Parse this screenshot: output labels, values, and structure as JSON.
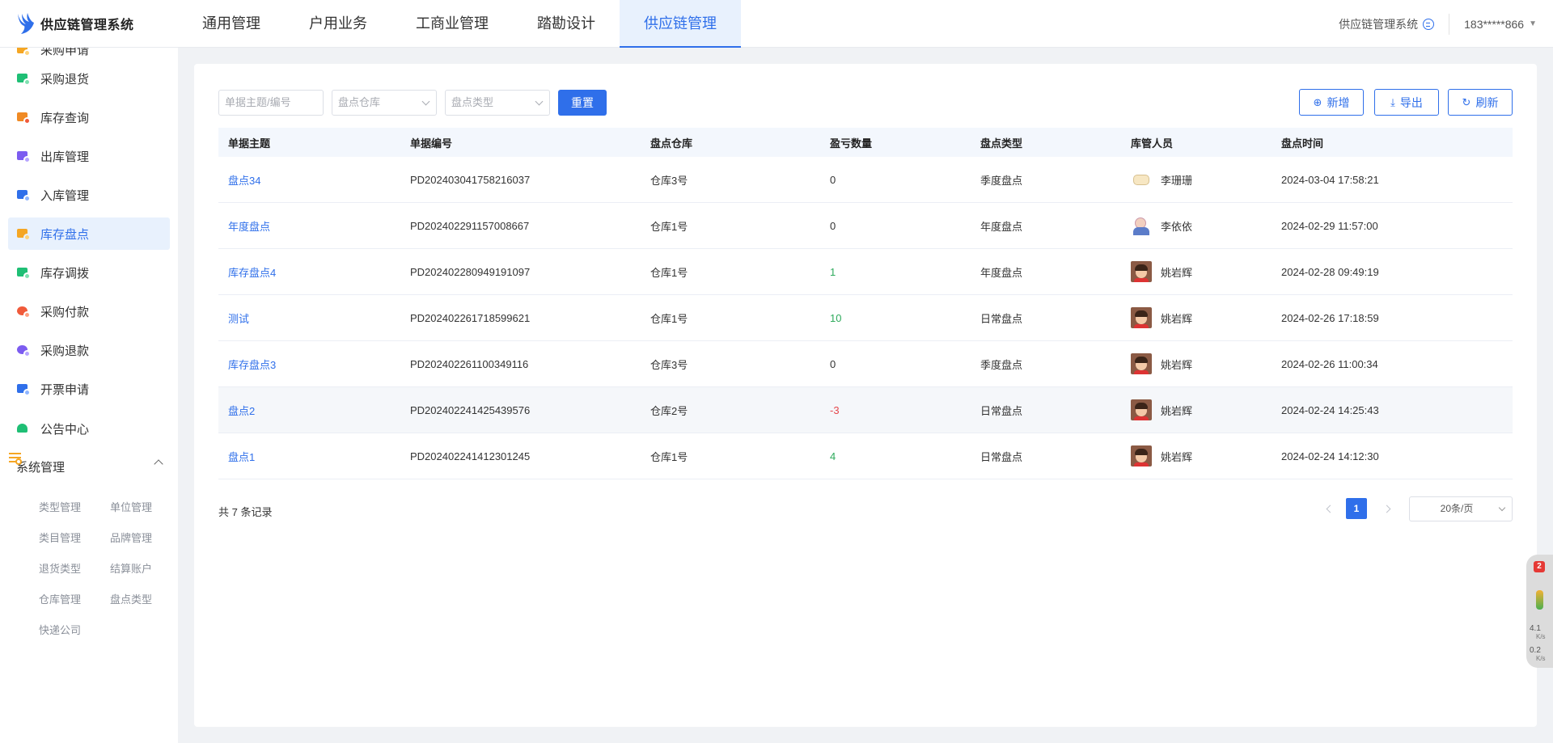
{
  "app": {
    "title": "供应链管理系统"
  },
  "top_nav": {
    "items": [
      {
        "label": "通用管理"
      },
      {
        "label": "户用业务"
      },
      {
        "label": "工商业管理"
      },
      {
        "label": "踏勘设计"
      },
      {
        "label": "供应链管理"
      }
    ],
    "active_index": 4
  },
  "header_right": {
    "system_name": "供应链管理系统",
    "user": "183*****866"
  },
  "sidebar": {
    "items": [
      {
        "label": "采购申请",
        "icon": "purchase-request-icon",
        "color": "#f5a623"
      },
      {
        "label": "采购退货",
        "icon": "cart-icon",
        "color": "#1fbf75"
      },
      {
        "label": "库存查询",
        "icon": "inventory-search-icon",
        "color": "#f08a24"
      },
      {
        "label": "出库管理",
        "icon": "outbound-icon",
        "color": "#7c5cf0"
      },
      {
        "label": "入库管理",
        "icon": "inbound-icon",
        "color": "#2f6fea"
      },
      {
        "label": "库存盘点",
        "icon": "stocktake-icon",
        "color": "#f5a623"
      },
      {
        "label": "库存调拨",
        "icon": "transfer-icon",
        "color": "#1fbf75"
      },
      {
        "label": "采购付款",
        "icon": "payment-icon",
        "color": "#f05a3a"
      },
      {
        "label": "采购退款",
        "icon": "refund-icon",
        "color": "#7c5cf0"
      },
      {
        "label": "开票申请",
        "icon": "invoice-icon",
        "color": "#2f6fea"
      },
      {
        "label": "公告中心",
        "icon": "bell-icon",
        "color": "#1fbf75"
      }
    ],
    "active_index": 5,
    "group": {
      "label": "系统管理",
      "icon": "settings-sliders-icon",
      "sub_items": [
        "类型管理",
        "单位管理",
        "类目管理",
        "品牌管理",
        "退货类型",
        "结算账户",
        "仓库管理",
        "盘点类型",
        "快递公司"
      ]
    }
  },
  "filters": {
    "subject_placeholder": "单据主题/编号",
    "warehouse_placeholder": "盘点仓库",
    "type_placeholder": "盘点类型",
    "reset_label": "重置"
  },
  "actions": {
    "add_label": "新增",
    "export_label": "导出",
    "refresh_label": "刷新"
  },
  "table": {
    "columns": [
      "单据主题",
      "单据编号",
      "盘点仓库",
      "盈亏数量",
      "盘点类型",
      "库管人员",
      "盘点时间"
    ],
    "rows": [
      {
        "subject": "盘点34",
        "number": "PD202403041758216037",
        "warehouse": "仓库3号",
        "qty": "0",
        "type": "季度盘点",
        "keeper": "李珊珊",
        "time": "2024-03-04 17:58:21"
      },
      {
        "subject": "年度盘点",
        "number": "PD202402291157008667",
        "warehouse": "仓库1号",
        "qty": "0",
        "type": "年度盘点",
        "keeper": "李依依",
        "time": "2024-02-29 11:57:00"
      },
      {
        "subject": "库存盘点4",
        "number": "PD202402280949191097",
        "warehouse": "仓库1号",
        "qty": "1",
        "type": "年度盘点",
        "keeper": "姚岩辉",
        "time": "2024-02-28 09:49:19"
      },
      {
        "subject": "测试",
        "number": "PD202402261718599621",
        "warehouse": "仓库1号",
        "qty": "10",
        "type": "日常盘点",
        "keeper": "姚岩辉",
        "time": "2024-02-26 17:18:59"
      },
      {
        "subject": "库存盘点3",
        "number": "PD202402261100349116",
        "warehouse": "仓库3号",
        "qty": "0",
        "type": "季度盘点",
        "keeper": "姚岩辉",
        "time": "2024-02-26 11:00:34"
      },
      {
        "subject": "盘点2",
        "number": "PD202402241425439576",
        "warehouse": "仓库2号",
        "qty": "-3",
        "type": "日常盘点",
        "keeper": "姚岩辉",
        "time": "2024-02-24 14:25:43"
      },
      {
        "subject": "盘点1",
        "number": "PD202402241412301245",
        "warehouse": "仓库1号",
        "qty": "4",
        "type": "日常盘点",
        "keeper": "姚岩辉",
        "time": "2024-02-24 14:12:30"
      }
    ]
  },
  "pagination": {
    "total_text": "共 7 条记录",
    "current_page": "1",
    "page_size": "20条/页"
  },
  "widget": {
    "badge": "2",
    "up_speed": "4.1",
    "down_speed": "0.2",
    "unit": "K/s"
  },
  "colors": {
    "primary": "#2f6fea",
    "positive": "#2eaa5c",
    "negative": "#e5484d"
  }
}
